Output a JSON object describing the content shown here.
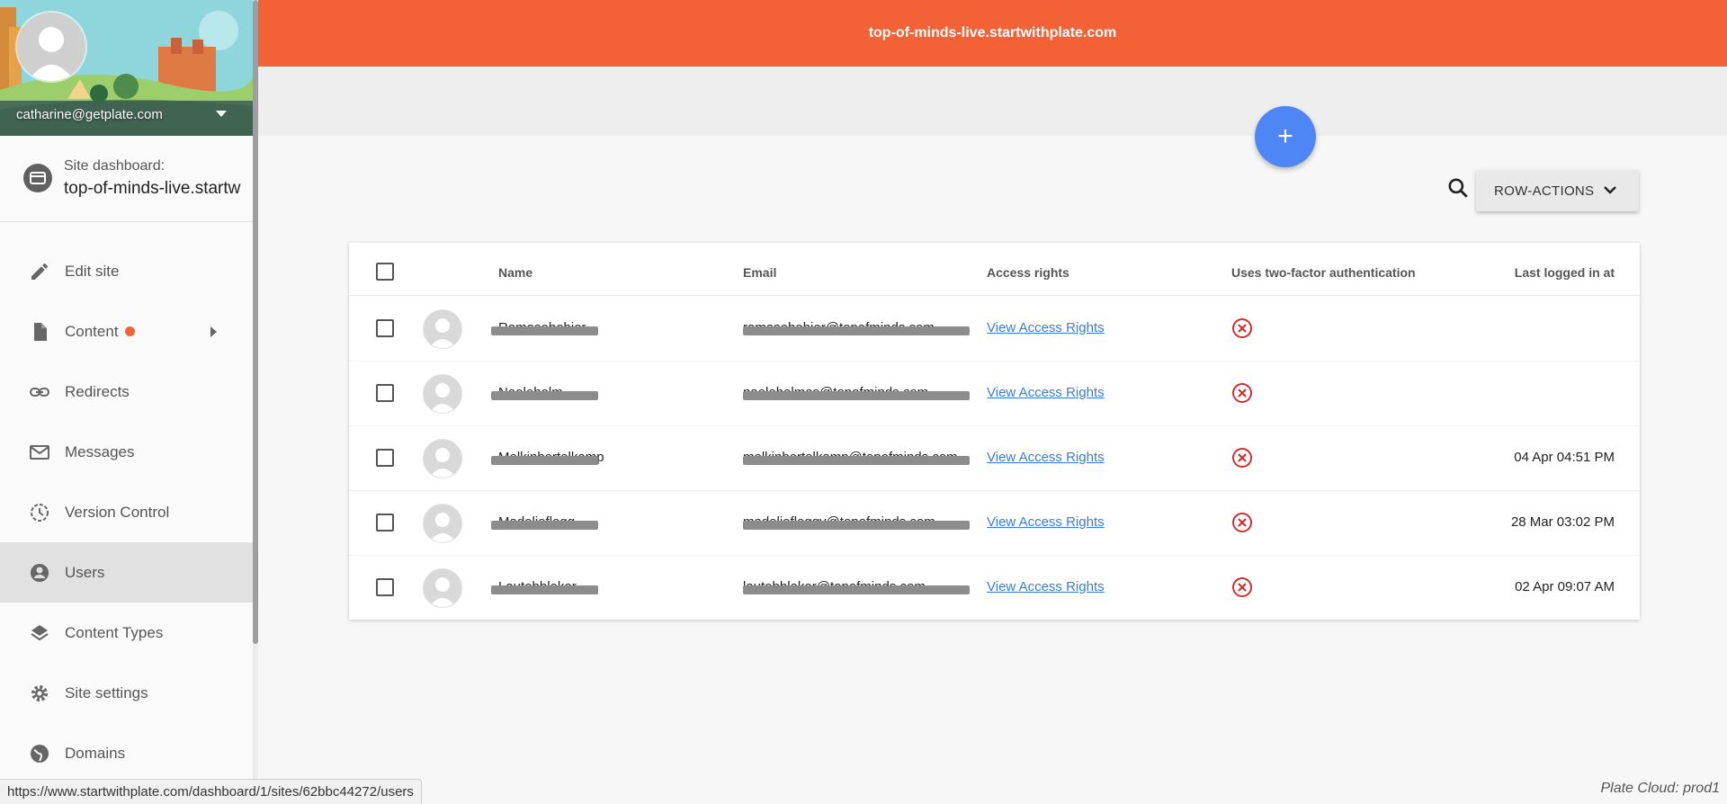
{
  "header": {
    "site_domain": "top-of-minds-live.startwithplate.com"
  },
  "sidebar": {
    "user_email": "catharine@getplate.com",
    "site_label": "Site dashboard:",
    "site_name": "top-of-minds-live.startw",
    "items": [
      {
        "label": "Edit site",
        "icon": "pencil-icon"
      },
      {
        "label": "Content",
        "icon": "document-icon",
        "has_badge": true,
        "has_submenu": true
      },
      {
        "label": "Redirects",
        "icon": "link-icon"
      },
      {
        "label": "Messages",
        "icon": "envelope-icon"
      },
      {
        "label": "Version Control",
        "icon": "history-icon"
      },
      {
        "label": "Users",
        "icon": "account-circle-icon",
        "active": true
      },
      {
        "label": "Content Types",
        "icon": "layers-icon"
      },
      {
        "label": "Site settings",
        "icon": "gear-icon"
      },
      {
        "label": "Domains",
        "icon": "globe-icon"
      }
    ]
  },
  "toolbar": {
    "add_label": "+",
    "row_actions_label": "ROW-ACTIONS"
  },
  "table": {
    "columns": [
      "Name",
      "Email",
      "Access rights",
      "Uses two-factor authentication",
      "Last logged in at"
    ],
    "rows": [
      {
        "name": "Ramasehobier",
        "email": "ramasehobier@topofminds.com",
        "access": "View Access Rights",
        "two_factor": false,
        "last_login": ""
      },
      {
        "name": "Naoleholm",
        "email": "naoleholmes@topofminds.com",
        "access": "View Access Rights",
        "two_factor": false,
        "last_login": ""
      },
      {
        "name": "Melkinbertelkamp",
        "email": "melkinbertelkamp@topofminds.com",
        "access": "View Access Rights",
        "two_factor": false,
        "last_login": "04 Apr 04:51 PM"
      },
      {
        "name": "Madelieflegg",
        "email": "madeliefleggy@topofminds.com",
        "access": "View Access Rights",
        "two_factor": false,
        "last_login": "28 Mar 03:02 PM"
      },
      {
        "name": "Lautobbleker",
        "email": "lautobbleker@topofminds.com",
        "access": "View Access Rights",
        "two_factor": false,
        "last_login": "02 Apr 09:07 AM"
      }
    ]
  },
  "status": {
    "url": "https://www.startwithplate.com/dashboard/1/sites/62bbc44272/users",
    "environment": "Plate Cloud: prod1"
  },
  "colors": {
    "brand": "#f26236",
    "fab": "#4e87f5",
    "link": "#3b7bdc",
    "error": "#d32f2f"
  }
}
